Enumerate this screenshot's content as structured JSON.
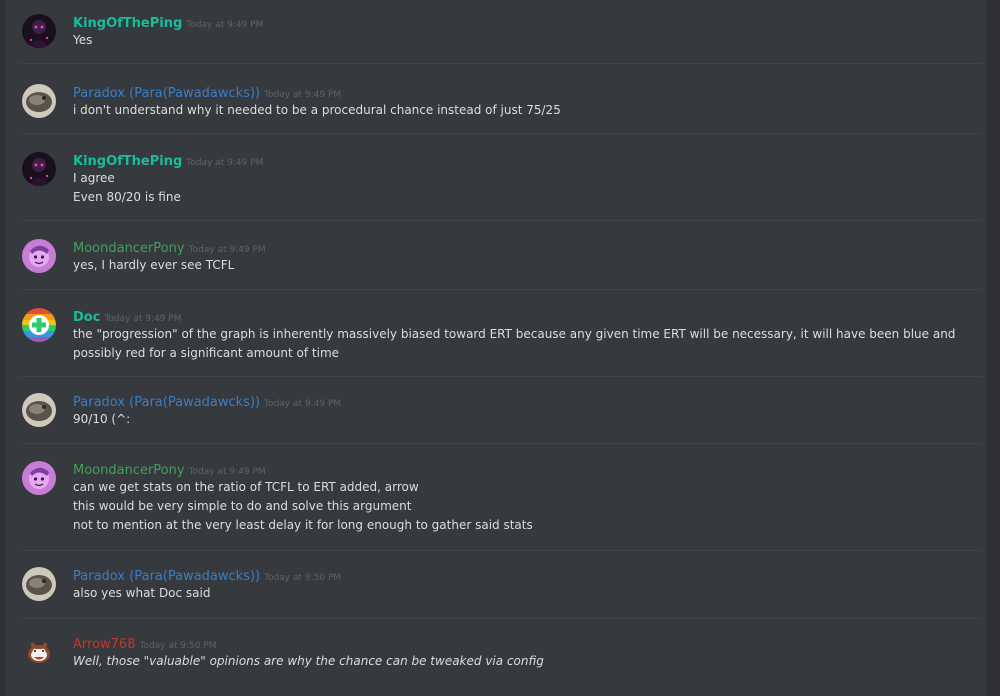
{
  "colors": {
    "background": "#36393e",
    "text": "#dcddde",
    "timestamp": "#5f6368",
    "name_teal": "#1abc9c",
    "name_blue": "#3a7ec6",
    "name_green": "#3fa15a",
    "name_red": "#c0392b"
  },
  "messages": [
    {
      "author": "KingOfThePing",
      "timestamp": "Today at 9:49 PM",
      "lines": [
        "Yes"
      ]
    },
    {
      "author": "Paradox (Para(Pawadawcks))",
      "timestamp": "Today at 9:49 PM",
      "lines": [
        "i don't understand why it needed to be a procedural chance instead of just 75/25"
      ]
    },
    {
      "author": "KingOfThePing",
      "timestamp": "Today at 9:49 PM",
      "lines": [
        "I agree",
        "Even 80/20 is fine"
      ]
    },
    {
      "author": "MoondancerPony",
      "timestamp": "Today at 9:49 PM",
      "lines": [
        "yes, I hardly ever see TCFL"
      ]
    },
    {
      "author": "Doc",
      "timestamp": "Today at 9:49 PM",
      "lines": [
        "the \"progression\" of the graph is inherently massively biased toward ERT because any given time ERT will be necessary, it will have been blue and possibly red for a significant amount of time"
      ]
    },
    {
      "author": "Paradox (Para(Pawadawcks))",
      "timestamp": "Today at 9:49 PM",
      "lines": [
        "90/10 (^:"
      ]
    },
    {
      "author": "MoondancerPony",
      "timestamp": "Today at 9:49 PM",
      "lines": [
        "can we get stats on the ratio of TCFL to ERT added, arrow",
        "this would be very simple to do and solve this argument",
        "not to mention at the very least delay it for long enough to gather said stats"
      ]
    },
    {
      "author": "Paradox (Para(Pawadawcks))",
      "timestamp": "Today at 9:50 PM",
      "lines": [
        "also yes what Doc said"
      ]
    },
    {
      "author": "Arrow768",
      "timestamp": "Today at 9:50 PM",
      "lines": [
        "Well, those \"valuable\" opinions are why the chance can be tweaked via config"
      ]
    }
  ]
}
